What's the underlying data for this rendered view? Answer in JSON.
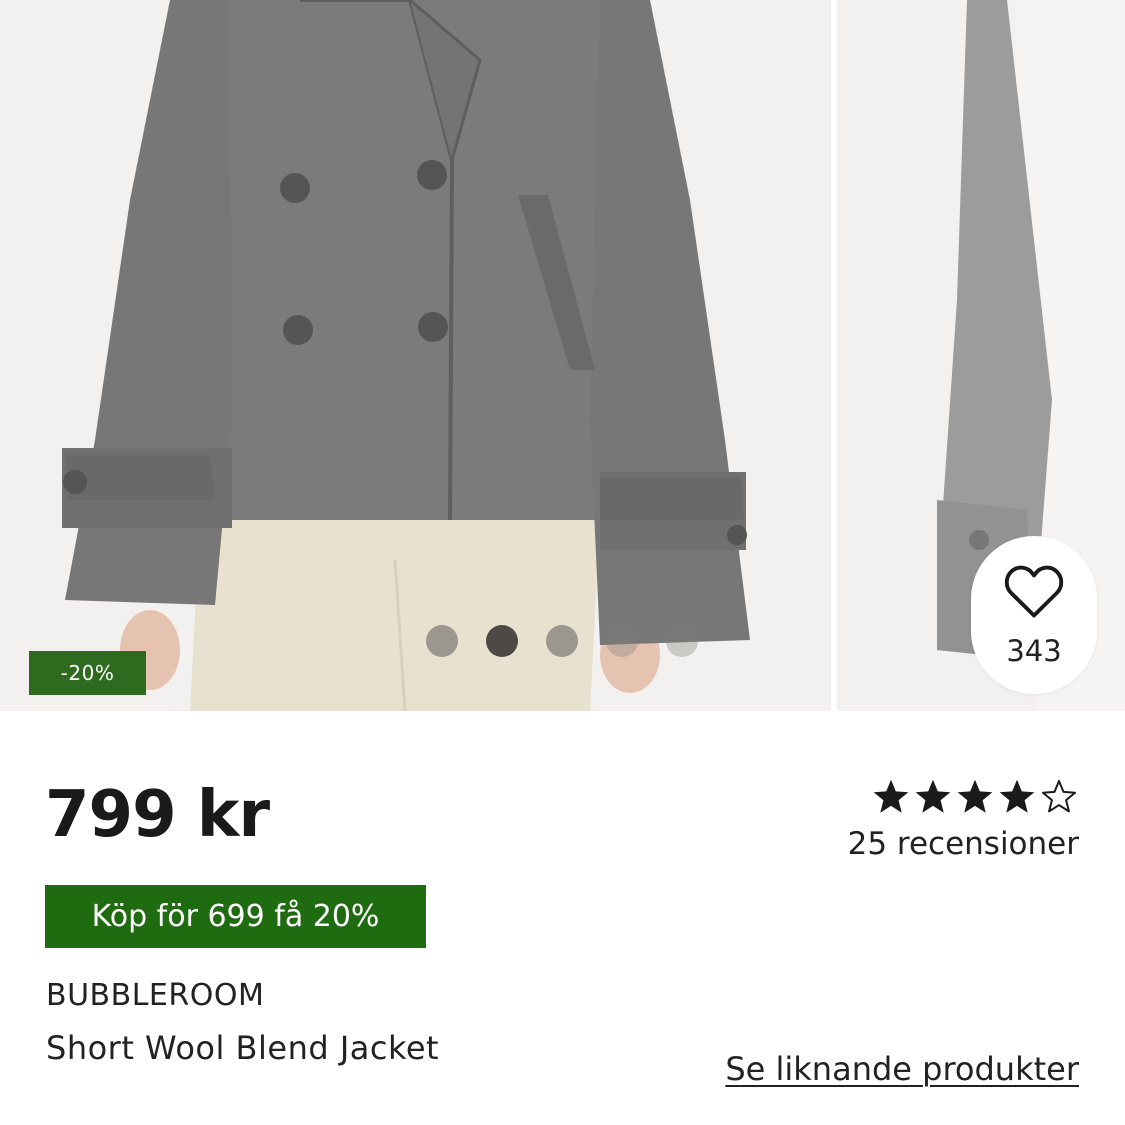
{
  "gallery": {
    "discount_badge": "-20%",
    "dots": {
      "count": 5,
      "active_index": 1
    },
    "favorites": {
      "icon": "heart-outline-icon",
      "count": "343"
    }
  },
  "product": {
    "price": "799 kr",
    "promo": "Köp för 699 få 20%",
    "brand": "BUBBLEROOM",
    "name": "Short Wool Blend Jacket"
  },
  "rating": {
    "stars": 4,
    "max": 5,
    "reviews_label": "25 recensioner"
  },
  "links": {
    "similar_products": "Se liknande produkter"
  },
  "colors": {
    "badge": "#2e6b1f",
    "promo": "#1e6b10",
    "jacket": "#7b7b7b",
    "trousers": "#e9e1d0"
  }
}
